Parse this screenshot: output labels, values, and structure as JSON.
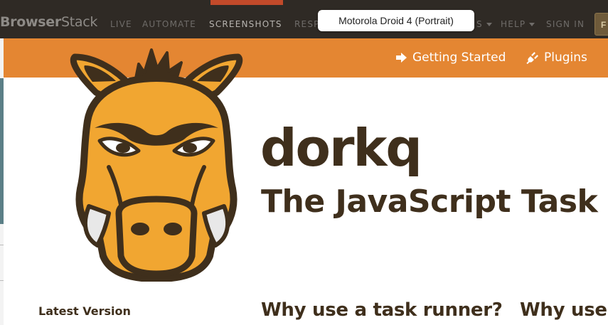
{
  "browserstack": {
    "brand_bold": "Browser",
    "brand_light": "Stack",
    "nav": [
      "LIVE",
      "AUTOMATE",
      "SCREENSHOTS",
      "RESP"
    ],
    "nav_right": [
      "S",
      "HELP",
      "SIGN IN"
    ],
    "signup_partial": "F",
    "device_tooltip": "Motorola Droid 4 (Portrait)"
  },
  "site": {
    "nav": {
      "getting_started": "Getting Started",
      "plugins": "Plugins"
    },
    "title": "dorkq",
    "subtitle": "The JavaScript Task R",
    "latest_version_label": "Latest Version",
    "why_heading_1": "Why use a task runner?",
    "why_heading_2": "Why use G"
  },
  "colors": {
    "topbar": "#2f2a25",
    "orange": "#e48632",
    "text_brown": "#3f2f1c",
    "logo_orange": "#f1a631",
    "logo_outline": "#3f2f1c"
  },
  "icons": {
    "getting_started": "arrow-right-icon",
    "plugins": "plug-icon",
    "dropdown": "caret-down-icon"
  }
}
